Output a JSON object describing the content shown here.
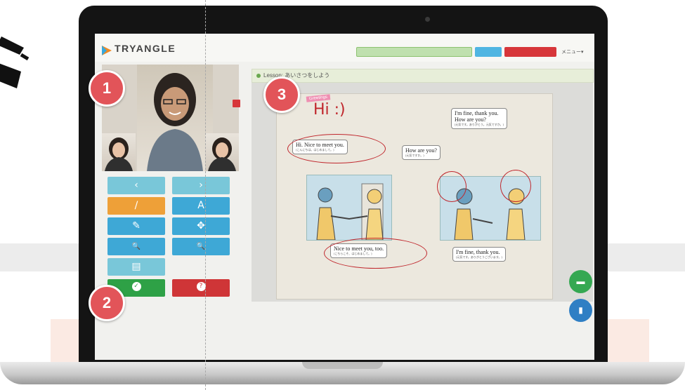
{
  "app": {
    "logo_text": "TRYANGLE",
    "logo_sub": "",
    "status_tag": "",
    "btn_blue": "",
    "btn_red": "",
    "menu_label": "メニュー▾"
  },
  "toolbar": {
    "prev": "‹",
    "next": "›",
    "pen": "/",
    "text_tool": "A",
    "eraser": "✎",
    "move": "✥",
    "zoom_out": "🔍",
    "zoom_in": "🔍",
    "clear": "▤",
    "ok": "✓",
    "help": "?"
  },
  "lesson": {
    "title": "Lesson: あいさつをしよう"
  },
  "page": {
    "sticker": "Greetings",
    "handwriting": "Hi :)",
    "bubble1_en": "Hi.  Nice to meet you.",
    "bubble1_jp": "(こんにちは。はじめまして。)",
    "bubble2_en": "How are you?",
    "bubble2_jp": "(元気ですか。)",
    "bubble3_en1": "I'm fine, thank you.",
    "bubble3_en2": "How are you?",
    "bubble3_jp": "(元気です。ありがとう。元気ですか。)",
    "bubble4_en": "Nice to meet you, too.",
    "bubble4_jp": "(こちらこそ、はじめまして。)",
    "bubble5_en": "I'm fine, thank you.",
    "bubble5_jp": "(元気です。ありがとうございます。)"
  },
  "badges": {
    "b1": "1",
    "b2": "2",
    "b3": "3"
  },
  "colors": {
    "badge": "#e25459",
    "accent_blue": "#3ea8d6",
    "accent_orange": "#eea038",
    "accent_green": "#2ea146",
    "accent_red": "#cf3537",
    "annotation_red": "#c0262c"
  }
}
